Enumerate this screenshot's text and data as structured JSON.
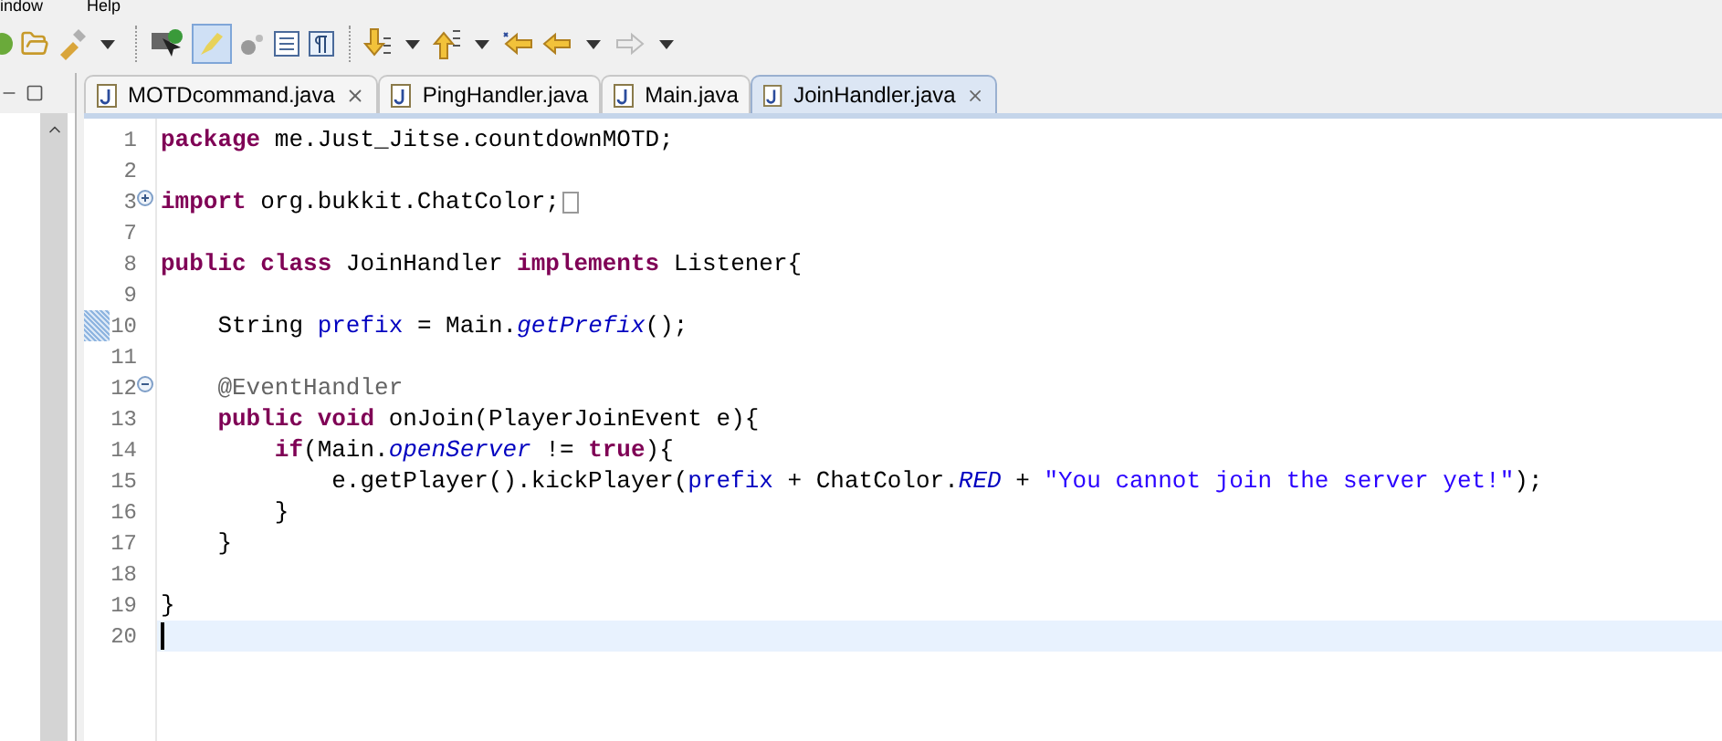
{
  "menu_bar": [
    "indow",
    "Help"
  ],
  "tabs": [
    {
      "label": "MOTDcommand.java",
      "selected": false,
      "close_icon": true
    },
    {
      "label": "PingHandler.java",
      "selected": false,
      "close_icon": false
    },
    {
      "label": "Main.java",
      "selected": false,
      "close_icon": false
    },
    {
      "label": "JoinHandler.java",
      "selected": true,
      "close_icon": true
    }
  ],
  "editor": {
    "lines": [
      {
        "number": "1",
        "tokens": [
          {
            "kind": "keyword",
            "text": "package"
          },
          {
            "kind": "plain",
            "text": " me.Just_Jitse.countdownMOTD;"
          }
        ]
      },
      {
        "number": "2"
      },
      {
        "number": "3",
        "folded": true,
        "folded_box": true,
        "tokens": [
          {
            "kind": "keyword",
            "text": "import"
          },
          {
            "kind": "plain",
            "text": " org.bukkit.ChatColor;"
          }
        ]
      },
      {
        "number": "7"
      },
      {
        "number": "8",
        "tokens": [
          {
            "kind": "keyword",
            "text": "public class"
          },
          {
            "kind": "plain",
            "text": " JoinHandler "
          },
          {
            "kind": "keyword",
            "text": "implements"
          },
          {
            "kind": "plain",
            "text": " Listener{"
          }
        ]
      },
      {
        "number": "9"
      },
      {
        "number": "10",
        "change_marker": true,
        "tokens": [
          {
            "kind": "plain",
            "text": "    String "
          },
          {
            "kind": "field",
            "text": "prefix"
          },
          {
            "kind": "plain",
            "text": " = Main."
          },
          {
            "kind": "static",
            "text": "getPrefix"
          },
          {
            "kind": "plain",
            "text": "();"
          }
        ]
      },
      {
        "number": "11"
      },
      {
        "number": "12",
        "folded": false,
        "tokens": [
          {
            "kind": "annotation",
            "text": "    @EventHandler"
          }
        ]
      },
      {
        "number": "13",
        "tokens": [
          {
            "kind": "keyword",
            "text": "    public void"
          },
          {
            "kind": "plain",
            "text": " onJoin(PlayerJoinEvent e){"
          }
        ]
      },
      {
        "number": "14",
        "tokens": [
          {
            "kind": "keyword",
            "text": "        if"
          },
          {
            "kind": "plain",
            "text": "(Main."
          },
          {
            "kind": "static",
            "text": "openServer"
          },
          {
            "kind": "plain",
            "text": " != "
          },
          {
            "kind": "keyword",
            "text": "true"
          },
          {
            "kind": "plain",
            "text": "){"
          }
        ]
      },
      {
        "number": "15",
        "tokens": [
          {
            "kind": "plain",
            "text": "            e.getPlayer().kickPlayer("
          },
          {
            "kind": "field",
            "text": "prefix"
          },
          {
            "kind": "plain",
            "text": " + ChatColor."
          },
          {
            "kind": "static",
            "text": "RED"
          },
          {
            "kind": "plain",
            "text": " + "
          },
          {
            "kind": "string",
            "text": "\"You cannot join the server yet!\""
          },
          {
            "kind": "plain",
            "text": ");"
          }
        ]
      },
      {
        "number": "16",
        "tokens": [
          {
            "kind": "plain",
            "text": "        }"
          }
        ]
      },
      {
        "number": "17",
        "tokens": [
          {
            "kind": "plain",
            "text": "    }"
          }
        ]
      },
      {
        "number": "18"
      },
      {
        "number": "19",
        "tokens": [
          {
            "kind": "plain",
            "text": "}"
          }
        ]
      },
      {
        "number": "20",
        "current": true
      }
    ]
  }
}
